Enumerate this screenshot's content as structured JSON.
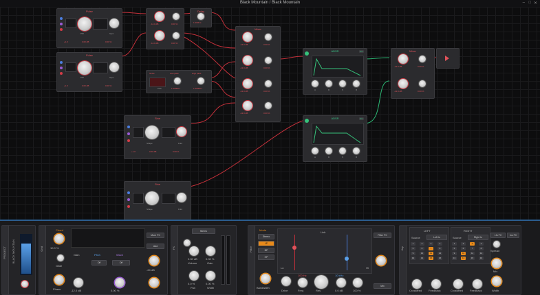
{
  "window": {
    "title": "Black Mountain / Black Mountain",
    "controls": [
      "minimize-icon",
      "maximize-icon",
      "close-icon"
    ]
  },
  "colors": {
    "accent_red": "#e0525a",
    "accent_green": "#36c27b",
    "accent_orange": "#e88a1a",
    "accent_blue": "#4b7ee0",
    "panel_border": "#2b5d8f"
  },
  "modules": {
    "osc1": {
      "title": "Pulse",
      "knob_labels": [
        "PW",
        "Sync"
      ],
      "values": [
        "+1.0",
        "0.00 dB",
        "0.00 %"
      ]
    },
    "osc2": {
      "title": "Pulse",
      "knob_labels": [
        "PW",
        "Sync"
      ],
      "values": [
        "+1.0",
        "0.00 dB",
        "0.00 %"
      ]
    },
    "attn_top": {
      "values": [
        "-12.0 dB",
        "0.00 %"
      ]
    },
    "attn_mid": {
      "values": [
        "-12.0 dB",
        "0.00 %"
      ]
    },
    "delay_small": {
      "title": "Delay",
      "values": [
        "1.0000 s"
      ]
    },
    "chain": {
      "titles": [
        "Noise",
        "Low pass",
        "High pass"
      ],
      "labels": [
        "Pink"
      ],
      "values": [
        "1.00000 s",
        "1.00000 s"
      ]
    },
    "mixer": {
      "title": "Mixer",
      "values": [
        "-12.0 dB",
        "0.00 %",
        "-12.0 dB",
        "0.00 %",
        "-12.0 dB",
        "0.00 %",
        "-12.0 dB",
        "0.00 %"
      ]
    },
    "adsr1": {
      "title": "ADSR",
      "badge": "M 1",
      "knob_labels": [
        "A",
        "D",
        "S",
        "R"
      ]
    },
    "adsr2": {
      "title": "ADSR",
      "badge": "M 1",
      "knob_labels": [
        "A",
        "D",
        "S",
        "R"
      ]
    },
    "vca": {
      "title": "Mixer",
      "values": [
        "-12.0 dB",
        "0.00 %",
        "-12.0 dB",
        "0.00 %"
      ]
    },
    "wavefolder1": {
      "title": "Sine",
      "knob_labels": [
        "Shape",
        "Fold"
      ],
      "values": [
        "+1.0",
        "0.00 dB",
        "0.00 %"
      ]
    },
    "wavefolder2": {
      "title": "Sine",
      "knob_labels": [
        "Shape",
        "Fold"
      ]
    }
  },
  "device_panel": {
    "project": {
      "label": "PROJECT",
      "sublabel": "BLACK MOUNTAIN"
    },
    "dev1": {
      "name": "Grid",
      "labels": {
        "chord": "Chord",
        "glide": "Glide",
        "gain": "Gain",
        "pitch": "Pitch",
        "wave": "Wave",
        "phase": "Phase",
        "input": "Input"
      },
      "values": {
        "knob1": "10.0 %",
        "knob2": "-24 dB",
        "knob3": "0.00 %",
        "wave_val": "Off",
        "phase_val": "Off",
        "gain_val": "-12.0 dB",
        "glide_val": "0.00 ms"
      },
      "buttons": [
        "More FX",
        "Add",
        "MIDI In",
        "Poly 8",
        "Voice Stack",
        "Off"
      ]
    },
    "dev2": {
      "name": "FX",
      "controls": {
        "dropdown": "Stereo",
        "knob_a": "0.00 dB",
        "knob_b": "0.00 %",
        "knob_c": "0.0 %",
        "knob_d": "0.00 %",
        "lbl_a": "Volume",
        "lbl_b": "Gain",
        "lbl_c": "Pan",
        "lbl_d": "Width"
      }
    },
    "dev3": {
      "name": "Filter",
      "mode_label": "Mode",
      "mode_value": "Stereo",
      "mode_buttons": [
        "LP",
        "BP",
        "HP"
      ],
      "labels": {
        "link": "Link",
        "bw": "Bandwidth",
        "drive": "Drive",
        "mix": "Mix",
        "freq": "Freq",
        "res": "Res",
        "lo": "Lo",
        "hi": "Hi"
      },
      "values": {
        "v1": "100 Hz",
        "v2": "-3.0 dB",
        "v3": "0.00 %",
        "v4": "0.0 dB",
        "v5": "100 %",
        "v6": "10 kHz"
      },
      "buttons": [
        "Filter FX",
        "Mix"
      ]
    },
    "dev4": {
      "name": "Arp",
      "left": {
        "label": "LEFT",
        "source_label": "Source",
        "source_value": "Left In"
      },
      "right": {
        "label": "RIGHT",
        "source_label": "Source",
        "source_value": "Right In"
      },
      "grid_left": [
        "1",
        "2",
        "3",
        "4",
        "5",
        "6",
        "7",
        "8",
        "9",
        "10",
        "11",
        "12",
        "13",
        "14",
        "15",
        "16"
      ],
      "grid_right": [
        "1",
        "2",
        "3",
        "4",
        "5",
        "6",
        "7",
        "8",
        "9",
        "10",
        "11",
        "12",
        "13",
        "14",
        "15",
        "16"
      ],
      "labels": {
        "mix": "Mix",
        "feedback_l": "Feedback",
        "feedback_r": "Feedback",
        "rate_l": "Crossfeed",
        "rate_r": "Crossfeed",
        "spread": "Spread",
        "width": "Width"
      },
      "buttons": [
        "Lfo FX",
        "Ins FX"
      ]
    }
  }
}
